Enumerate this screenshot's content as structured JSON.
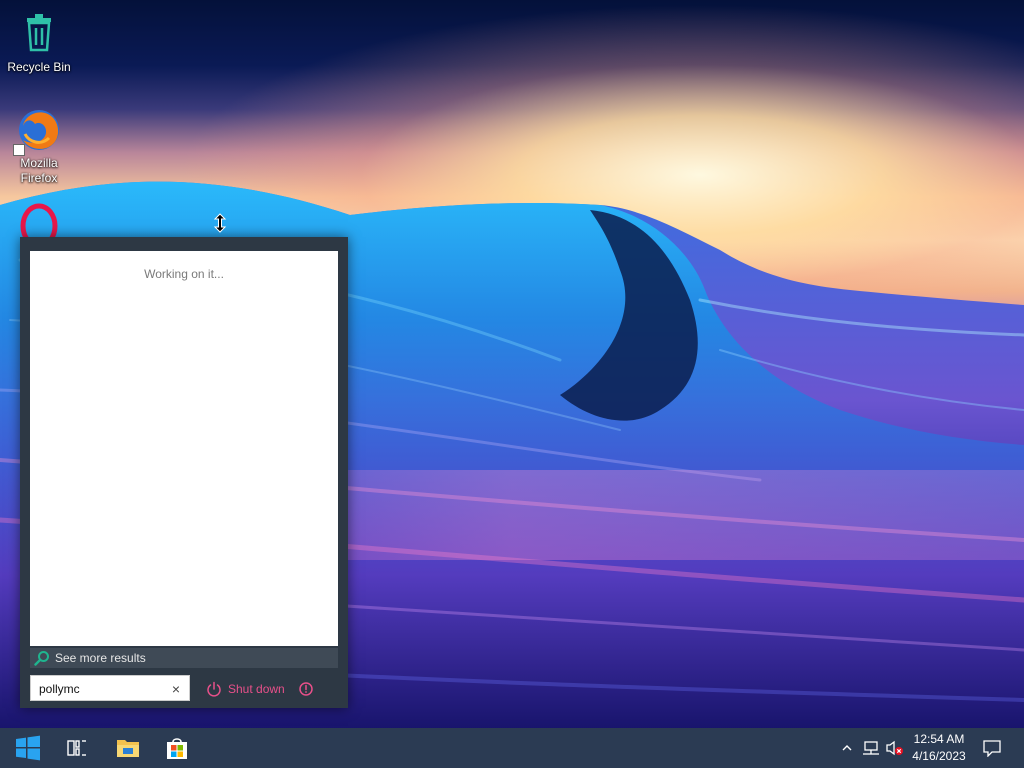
{
  "desktop": {
    "icons": [
      {
        "label": "Recycle Bin",
        "icon": "recycle-bin-icon"
      },
      {
        "label": "Mozilla Firefox",
        "icon": "firefox-icon"
      },
      {
        "label": "",
        "icon": "opera-icon"
      }
    ]
  },
  "start_menu": {
    "status_text": "Working on it...",
    "see_more_label": "See more results",
    "search": {
      "value": "pollymc",
      "placeholder": ""
    },
    "clear_label": "×",
    "shutdown_label": "Shut down"
  },
  "taskbar": {
    "buttons": [
      "start-windows-icon",
      "task-view-icon",
      "file-explorer-icon",
      "store-icon"
    ],
    "tray_icons": [
      "chevron-up-icon",
      "network-icon",
      "volume-muted-icon",
      "action-center-icon"
    ],
    "clock": {
      "time": "12:54 AM",
      "date": "4/16/2023"
    }
  },
  "colors": {
    "panel_bg": "#2d3844",
    "taskbar_bg": "#2b3b53",
    "accent_pink": "#e8508a",
    "search_green": "#1fb58f"
  }
}
